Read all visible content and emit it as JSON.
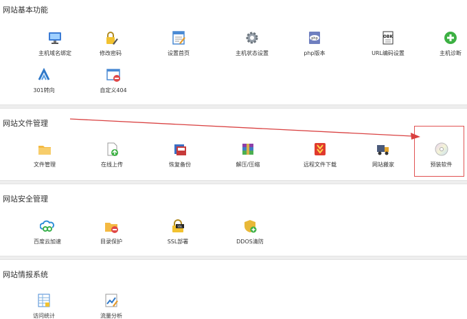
{
  "sections": [
    {
      "title": "网站基本功能",
      "items": [
        {
          "label": "主机域名绑定",
          "icon": "monitor-network-icon"
        },
        {
          "label": "修改密码",
          "icon": "lock-edit-icon"
        },
        {
          "label": "设置首页",
          "icon": "homepage-edit-icon"
        },
        {
          "label": "主机状态设置",
          "icon": "gear-icon"
        },
        {
          "label": "php版本",
          "icon": "php-icon"
        },
        {
          "label": "URL编码设置",
          "icon": "obk-document-icon"
        },
        {
          "label": "主机诊断",
          "icon": "green-plus-icon"
        },
        {
          "label": "301转向",
          "icon": "redirect-arrows-icon"
        },
        {
          "label": "自定义404",
          "icon": "custom-404-icon"
        }
      ]
    },
    {
      "title": "网站文件管理",
      "items": [
        {
          "label": "文件管理",
          "icon": "folder-icon"
        },
        {
          "label": "在线上传",
          "icon": "upload-file-icon"
        },
        {
          "label": "恢复备份",
          "icon": "backup-restore-icon"
        },
        {
          "label": "解压/压缩",
          "icon": "archive-icon"
        },
        {
          "label": "远程文件下载",
          "icon": "download-icon"
        },
        {
          "label": "网站搬家",
          "icon": "moving-truck-icon"
        },
        {
          "label": "预装软件",
          "icon": "cd-disc-icon"
        }
      ]
    },
    {
      "title": "网站安全管理",
      "items": [
        {
          "label": "百度云加速",
          "icon": "cloud-link-icon"
        },
        {
          "label": "目录保护",
          "icon": "folder-block-icon"
        },
        {
          "label": "SSL部署",
          "icon": "ssl-lock-icon"
        },
        {
          "label": "DDOS清防",
          "icon": "shield-plus-icon"
        }
      ]
    },
    {
      "title": "网站情报系统",
      "items": [
        {
          "label": "访问统计",
          "icon": "statistics-table-icon"
        },
        {
          "label": "流量分析",
          "icon": "traffic-chart-icon"
        }
      ]
    }
  ],
  "colors": {
    "highlight": "#e05050",
    "arrow": "#d94040"
  }
}
